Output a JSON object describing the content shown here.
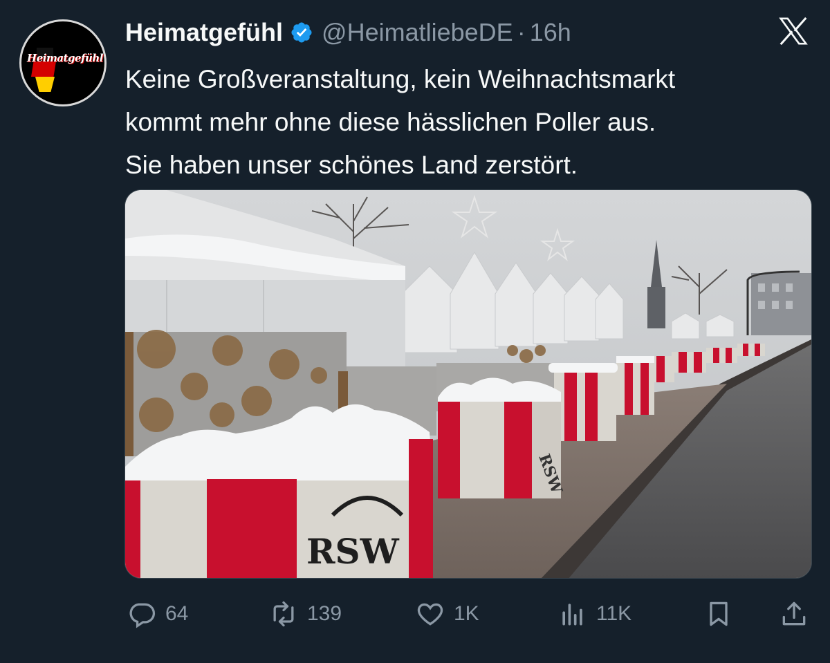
{
  "account": {
    "display_name": "Heimatgefühl",
    "handle": "@HeimatliebeDE",
    "separator": "·",
    "time": "16h",
    "avatar_text": "Heimatgefühl",
    "verified_color": "#1d9bf0"
  },
  "tweet": {
    "lines": [
      "Keine Großveranstaltung, kein Weihnachtsmarkt",
      "kommt mehr ohne diese hässlichen Poller aus.",
      "Sie haben unser schönes Land zerstört."
    ]
  },
  "media": {
    "barrier_text": "RSW",
    "colors": {
      "barrier_red": "#c8102e",
      "concrete": "#d9d6cf",
      "snow": "#f4f5f6",
      "sky": "#c9cccf"
    }
  },
  "actions": {
    "replies": "64",
    "reposts": "139",
    "likes": "1K",
    "views": "11K",
    "icons": [
      "reply-icon",
      "repost-icon",
      "like-icon",
      "views-icon",
      "bookmark-icon",
      "share-icon"
    ]
  },
  "theme": {
    "background": "#15202b",
    "text": "#f7f9f9",
    "muted": "#8b98a5"
  }
}
